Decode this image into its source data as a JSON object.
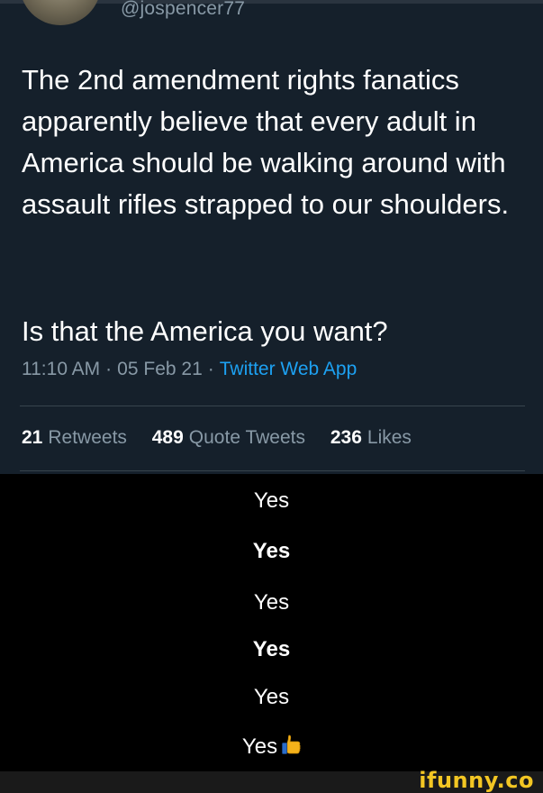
{
  "tweet": {
    "handle": "@jospencer77",
    "paragraph_1": "The 2nd amendment rights fanatics apparently believe that every adult in America should be walking around with assault rifles strapped to our shoulders.",
    "paragraph_2": "Is that the America you want?",
    "time": "11:10 AM",
    "date": "05 Feb 21",
    "separator": "·",
    "source": "Twitter Web App",
    "stats": {
      "retweets_count": "21",
      "retweets_label": "Retweets",
      "quote_tweets_count": "489",
      "quote_tweets_label": "Quote Tweets",
      "likes_count": "236",
      "likes_label": "Likes"
    }
  },
  "replies": [
    "Yes",
    "Yes",
    "Yes",
    "Yes",
    "Yes",
    "Yes"
  ],
  "reply_emoji": "thumbs-up-icon",
  "watermark": "ifunny.co",
  "colors": {
    "tweet_background": "#15202b",
    "page_background": "#000000",
    "muted_text": "#8899a6",
    "link": "#1da1f2",
    "watermark": "#f3c623"
  }
}
